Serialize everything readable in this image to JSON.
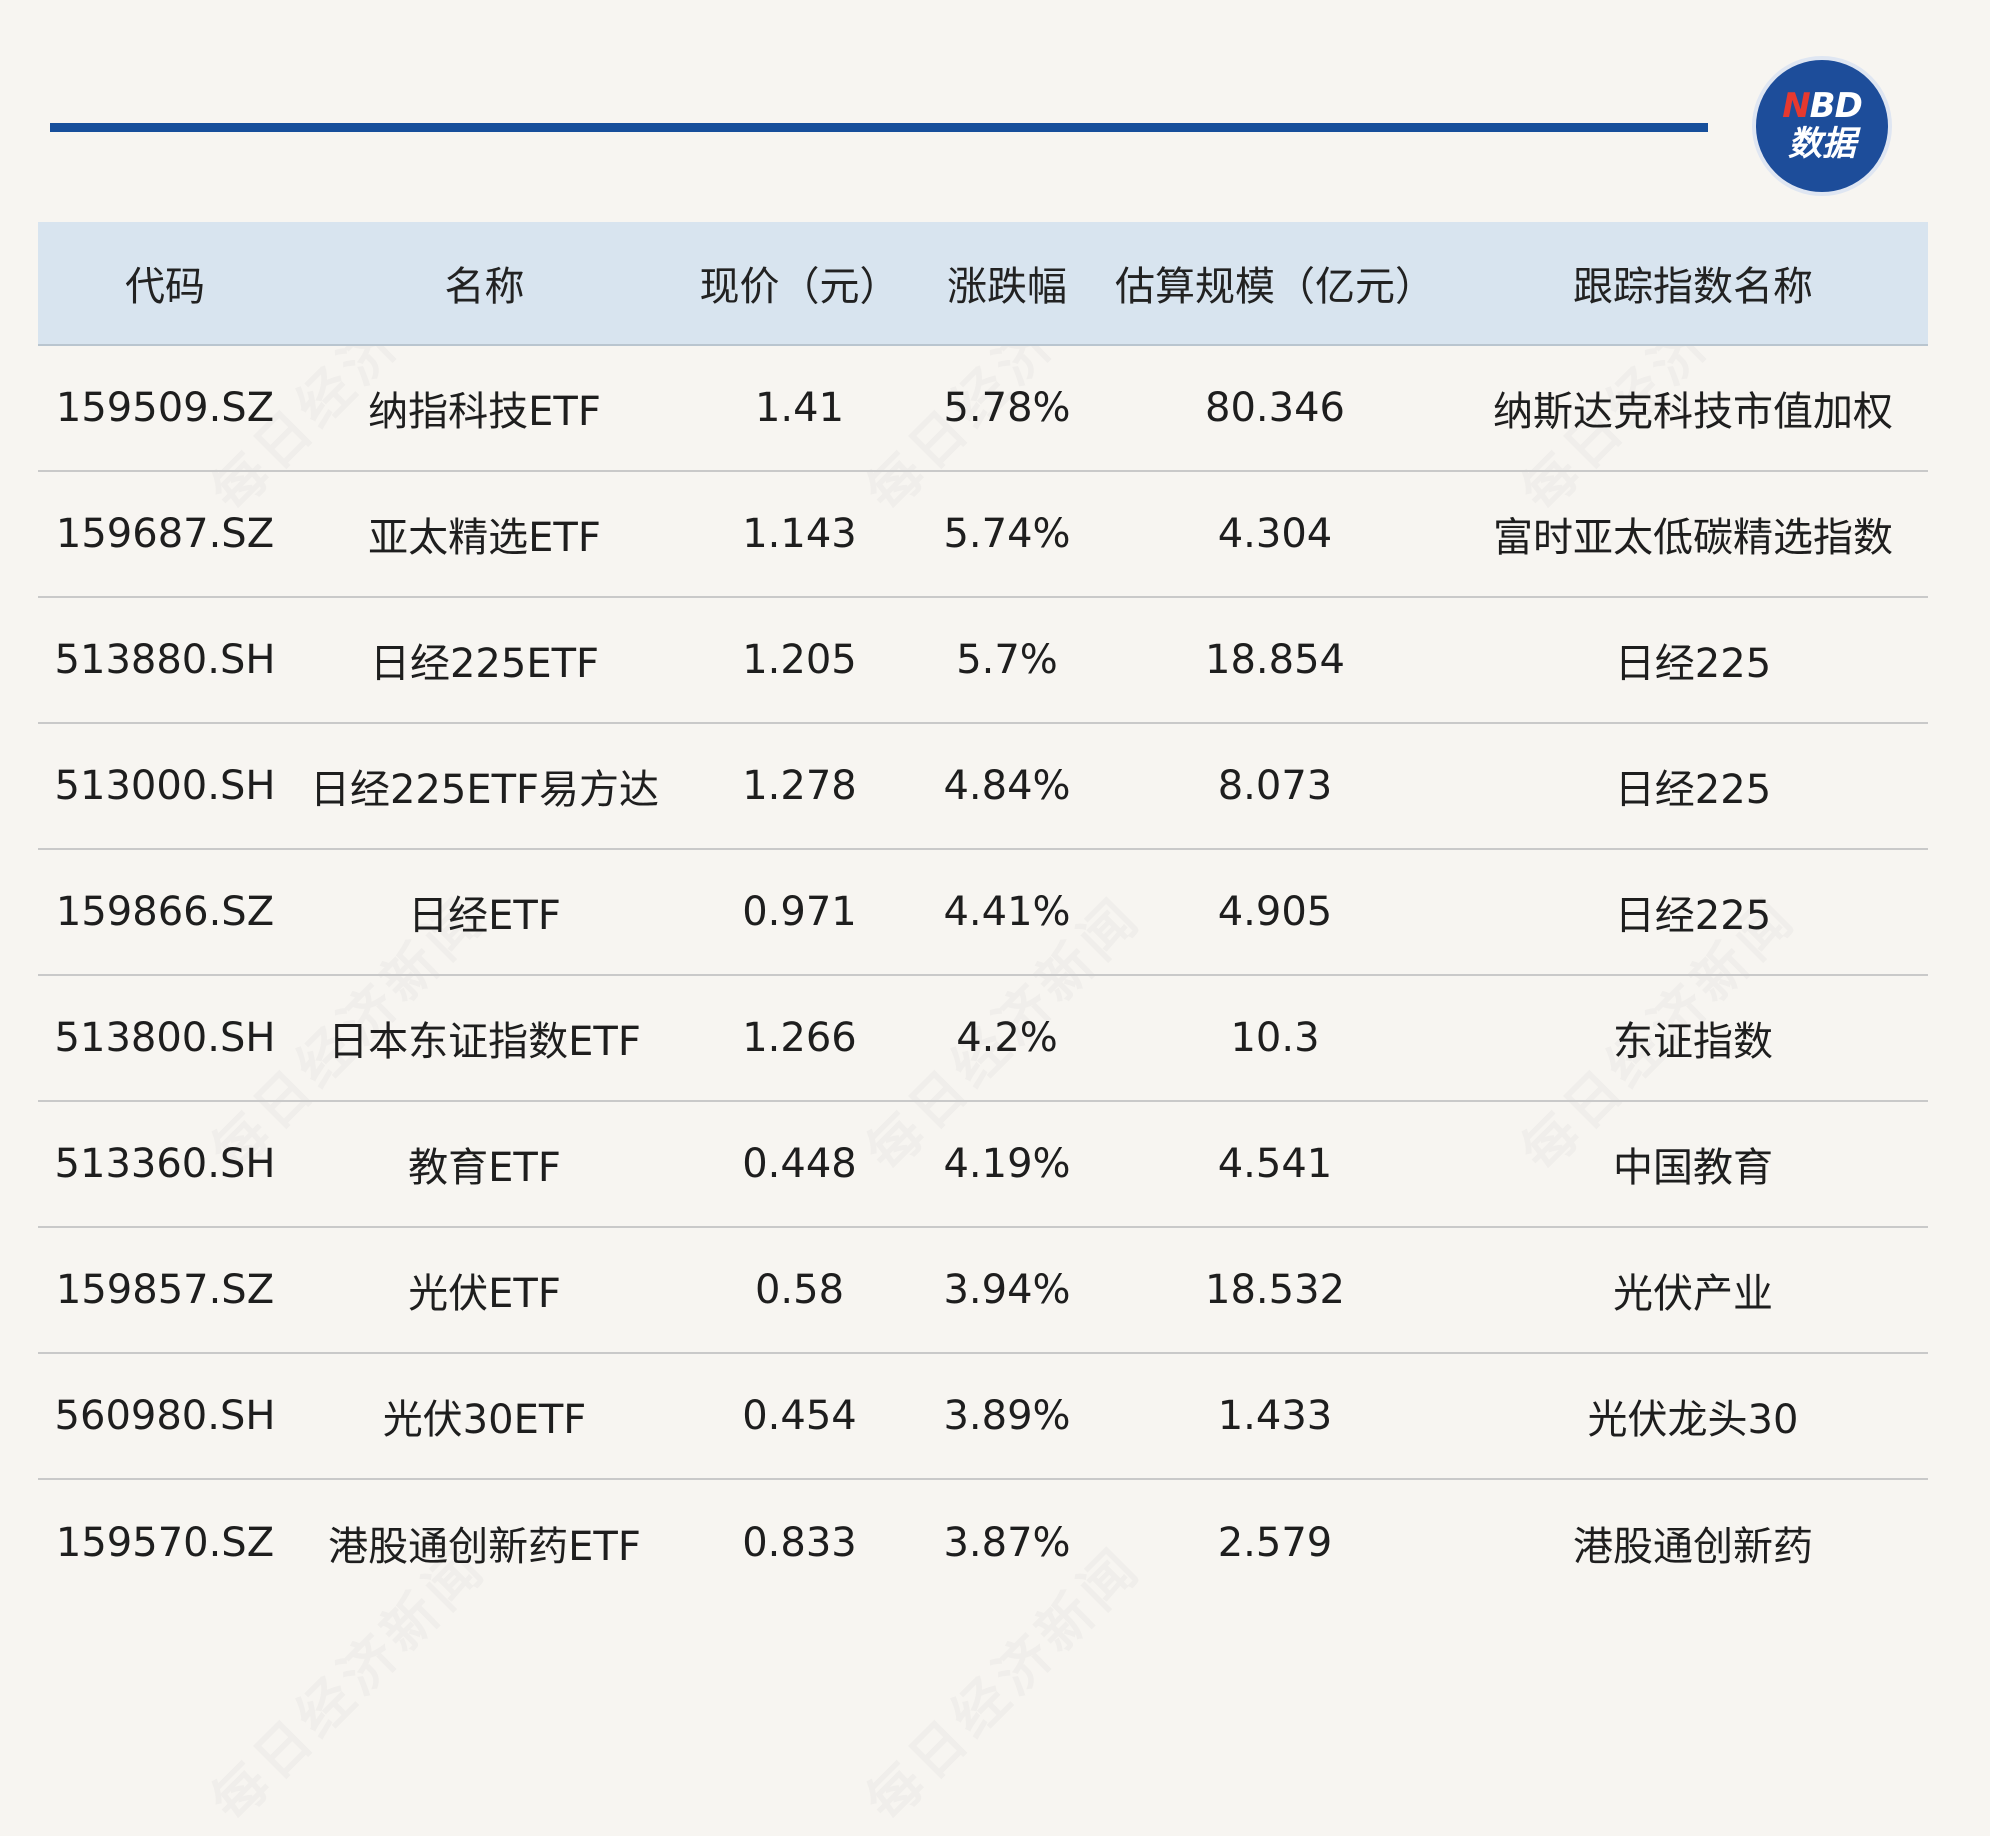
{
  "logo": {
    "n": "N",
    "bd": "BD",
    "sub": "数据"
  },
  "watermark": "每日经济新闻",
  "table": {
    "headers": [
      "代码",
      "名称",
      "现价（元）",
      "涨跌幅",
      "估算规模（亿元）",
      "跟踪指数名称"
    ],
    "rows": [
      [
        "159509.SZ",
        "纳指科技ETF",
        "1.41",
        "5.78%",
        "80.346",
        "纳斯达克科技市值加权"
      ],
      [
        "159687.SZ",
        "亚太精选ETF",
        "1.143",
        "5.74%",
        "4.304",
        "富时亚太低碳精选指数"
      ],
      [
        "513880.SH",
        "日经225ETF",
        "1.205",
        "5.7%",
        "18.854",
        "日经225"
      ],
      [
        "513000.SH",
        "日经225ETF易方达",
        "1.278",
        "4.84%",
        "8.073",
        "日经225"
      ],
      [
        "159866.SZ",
        "日经ETF",
        "0.971",
        "4.41%",
        "4.905",
        "日经225"
      ],
      [
        "513800.SH",
        "日本东证指数ETF",
        "1.266",
        "4.2%",
        "10.3",
        "东证指数"
      ],
      [
        "513360.SH",
        "教育ETF",
        "0.448",
        "4.19%",
        "4.541",
        "中国教育"
      ],
      [
        "159857.SZ",
        "光伏ETF",
        "0.58",
        "3.94%",
        "18.532",
        "光伏产业"
      ],
      [
        "560980.SH",
        "光伏30ETF",
        "0.454",
        "3.89%",
        "1.433",
        "光伏龙头30"
      ],
      [
        "159570.SZ",
        "港股通创新药ETF",
        "0.833",
        "3.87%",
        "2.579",
        "港股通创新药"
      ]
    ]
  },
  "colors": {
    "background": "#f7f5f1",
    "accent_line": "#174f9b",
    "header_bg": "#d8e4ef",
    "logo_bg": "#1d4d9a",
    "logo_n": "#e6392f"
  }
}
